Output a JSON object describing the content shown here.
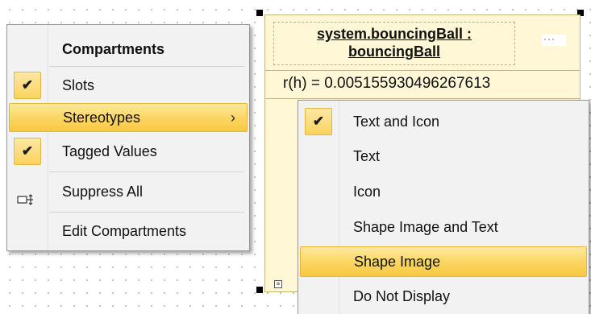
{
  "node": {
    "title": "system.bouncingBall : bouncingBall",
    "slot_value": "r(h) = 0.005155930496267613",
    "head_ellipsis": "···"
  },
  "context_menu": {
    "header": "Compartments",
    "items": [
      {
        "label": "Slots",
        "checked": true
      },
      {
        "label": "Stereotypes",
        "highlighted": true,
        "submenu_arrow": "›"
      },
      {
        "label": "Tagged Values",
        "checked": true
      },
      {
        "label": "Suppress All",
        "icon": "suppress-compartments-icon"
      },
      {
        "label": "Edit Compartments"
      }
    ],
    "check_glyph": "✔"
  },
  "stereotypes_submenu": {
    "items": [
      {
        "label": "Text and Icon",
        "checked": true
      },
      {
        "label": "Text"
      },
      {
        "label": "Icon"
      },
      {
        "label": "Shape Image and Text"
      },
      {
        "label": "Shape Image",
        "highlighted": true
      },
      {
        "label": "Do Not Display"
      }
    ]
  },
  "colors": {
    "highlight": "#fbd560",
    "menu_background": "#f2f2f2",
    "node_fill": "#fff7d6"
  }
}
